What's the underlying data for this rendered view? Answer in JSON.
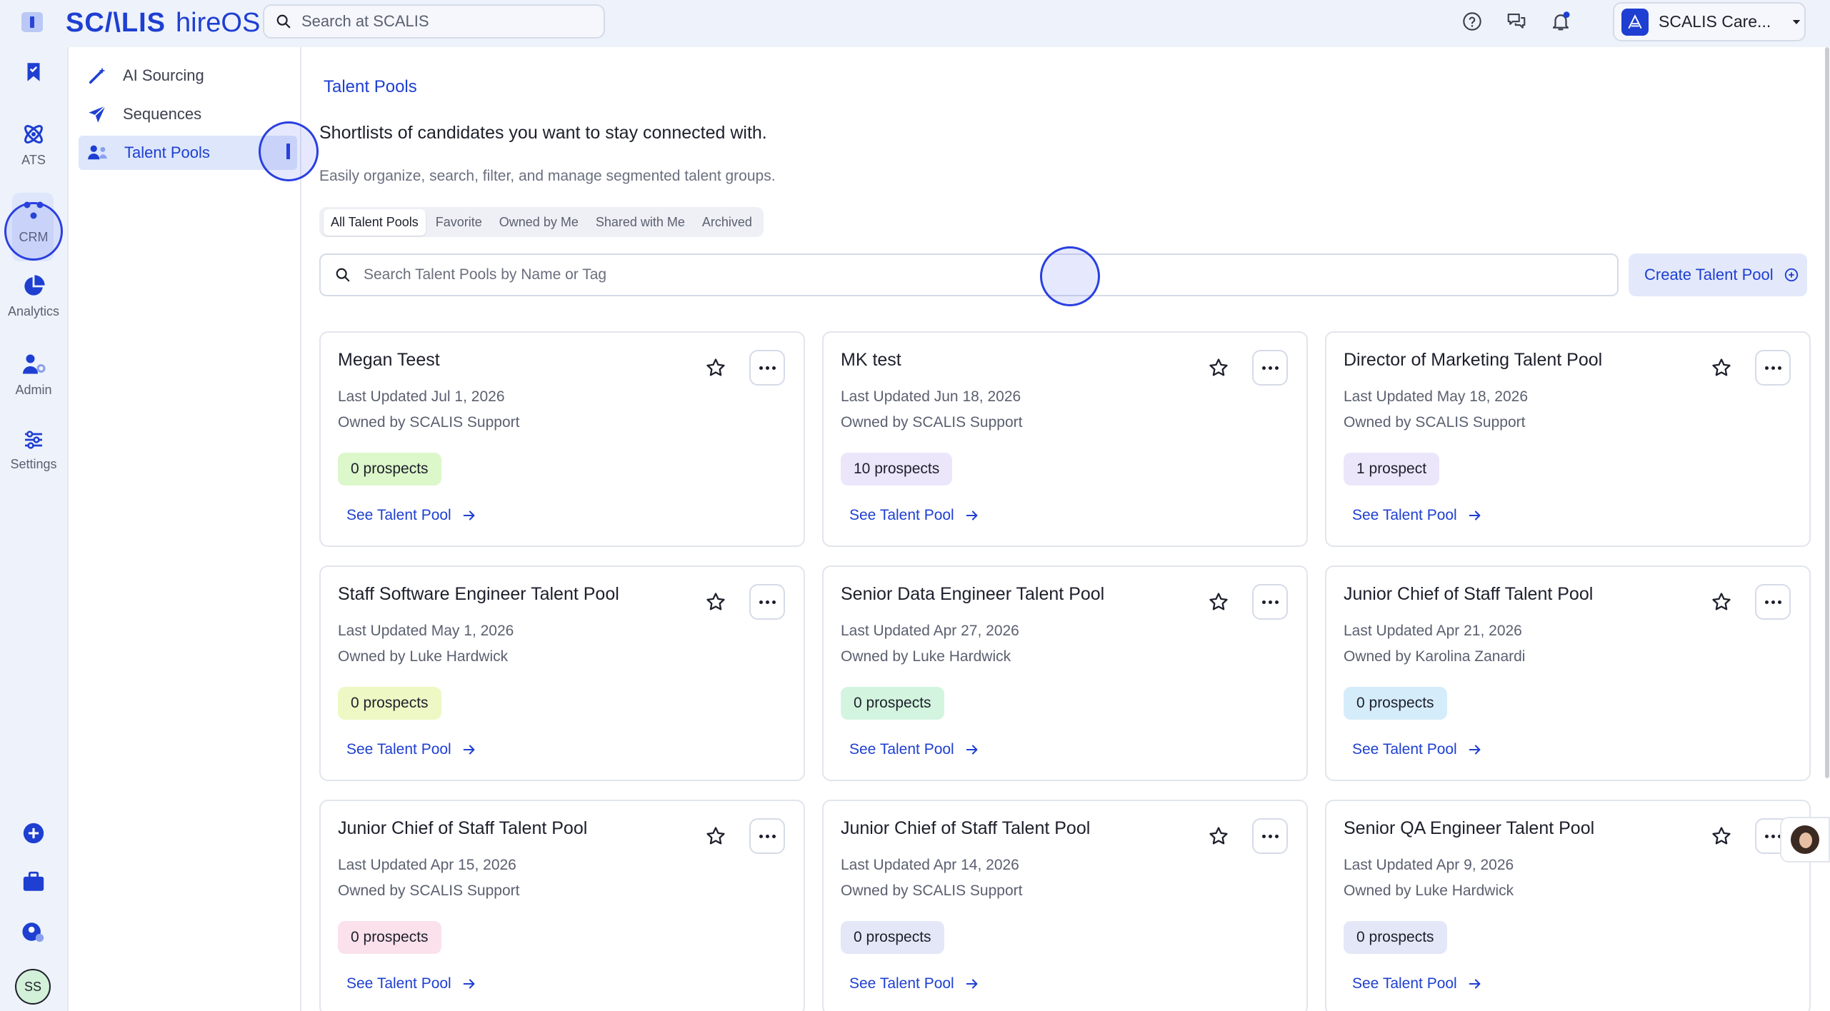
{
  "app": {
    "brand_main": "SC/\\LIS",
    "brand_suffix": "hireOS"
  },
  "search": {
    "placeholder": "Search at SCALIS"
  },
  "org": {
    "name": "SCALIS Care..."
  },
  "rail": {
    "items": [
      {
        "label": ""
      },
      {
        "label": "ATS"
      },
      {
        "label": "CRM"
      },
      {
        "label": "Analytics"
      },
      {
        "label": "Admin"
      },
      {
        "label": "Settings"
      }
    ],
    "avatar_initials": "SS"
  },
  "subnav": {
    "items": [
      {
        "label": "AI Sourcing"
      },
      {
        "label": "Sequences"
      },
      {
        "label": "Talent Pools"
      }
    ]
  },
  "main": {
    "breadcrumb": "Talent Pools",
    "heading": "Shortlists of candidates you want to stay connected with.",
    "subheading": "Easily organize, search, filter, and manage segmented talent groups.",
    "tabs": [
      {
        "label": "All Talent Pools"
      },
      {
        "label": "Favorite"
      },
      {
        "label": "Owned by Me"
      },
      {
        "label": "Shared with Me"
      },
      {
        "label": "Archived"
      }
    ],
    "search_placeholder": "Search Talent Pools by Name or Tag",
    "create_label": "Create Talent Pool",
    "link_label": "See Talent Pool"
  },
  "cards": [
    {
      "title": "Megan Teest",
      "updated": "Last Updated Jul 1, 2026",
      "owner": "Owned by SCALIS Support",
      "badge": "0 prospects",
      "badge_color": "#dcf7c9"
    },
    {
      "title": "MK test",
      "updated": "Last Updated Jun 18, 2026",
      "owner": "Owned by SCALIS Support",
      "badge": "10 prospects",
      "badge_color": "#ece6fb"
    },
    {
      "title": "Director of Marketing Talent Pool",
      "updated": "Last Updated May 18, 2026",
      "owner": "Owned by SCALIS Support",
      "badge": "1 prospect",
      "badge_color": "#ece6fb"
    },
    {
      "title": "Staff Software Engineer Talent Pool",
      "updated": "Last Updated May 1, 2026",
      "owner": "Owned by Luke Hardwick",
      "badge": "0 prospects",
      "badge_color": "#eef8c4"
    },
    {
      "title": "Senior Data Engineer Talent Pool",
      "updated": "Last Updated Apr 27, 2026",
      "owner": "Owned by Luke Hardwick",
      "badge": "0 prospects",
      "badge_color": "#d3f5df"
    },
    {
      "title": "Junior Chief of Staff Talent Pool",
      "updated": "Last Updated Apr 21, 2026",
      "owner": "Owned by Karolina Zanardi",
      "badge": "0 prospects",
      "badge_color": "#d5ecfa"
    },
    {
      "title": "Junior Chief of Staff Talent Pool",
      "updated": "Last Updated Apr 15, 2026",
      "owner": "Owned by SCALIS Support",
      "badge": "0 prospects",
      "badge_color": "#fbe1ec"
    },
    {
      "title": "Junior Chief of Staff Talent Pool",
      "updated": "Last Updated Apr 14, 2026",
      "owner": "Owned by SCALIS Support",
      "badge": "0 prospects",
      "badge_color": "#e3e7f7"
    },
    {
      "title": "Senior QA Engineer Talent Pool",
      "updated": "Last Updated Apr 9, 2026",
      "owner": "Owned by Luke Hardwick",
      "badge": "0 prospects",
      "badge_color": "#e3e7f7"
    }
  ],
  "colors": {
    "accent": "#1e3fd1",
    "rail_bg": "#eef2fb",
    "active_bg": "#dde6fb"
  }
}
